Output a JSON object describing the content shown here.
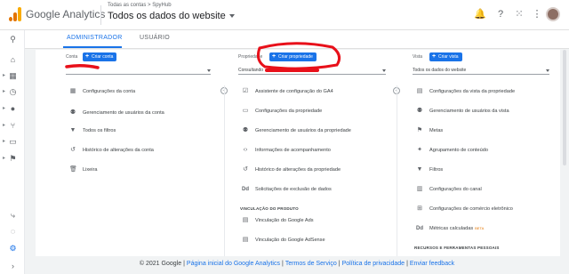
{
  "header": {
    "app_name": "Google Analytics",
    "breadcrumb": "Todas as contas > SpyHub",
    "property_title": "Todos os dados do website",
    "icons": [
      "bell-icon",
      "help-icon",
      "apps-icon",
      "more-vert-icon"
    ]
  },
  "tabs": [
    "ADMINISTRADOR",
    "USUÁRIO"
  ],
  "account": {
    "header": "Conta",
    "create_label": "Criar conta",
    "items": [
      {
        "icon": "building-icon",
        "label": "Configurações da conta"
      },
      {
        "icon": "people-icon",
        "label": "Gerenciamento de usuários da conta"
      },
      {
        "icon": "filter-icon",
        "label": "Todos os filtros"
      },
      {
        "icon": "history-icon",
        "label": "Histórico de alterações da conta"
      },
      {
        "icon": "trash-icon",
        "label": "Lixeira"
      }
    ]
  },
  "property": {
    "header": "Propriedade",
    "create_label": "Criar propriedade",
    "select_prefix": "Consultando",
    "items": [
      {
        "icon": "check-circle-icon",
        "label": "Assistente de configuração do GA4"
      },
      {
        "icon": "window-icon",
        "label": "Configurações da propriedade"
      },
      {
        "icon": "people-icon",
        "label": "Gerenciamento de usuários da propriedade"
      },
      {
        "icon": "code-icon",
        "label": "Informações de acompanhamento"
      },
      {
        "icon": "history-icon",
        "label": "Histórico de alterações da propriedade"
      },
      {
        "icon": "dd-icon",
        "label": "Solicitações de exclusão de dados"
      }
    ],
    "section_title": "VINCULAÇÃO DO PRODUTO",
    "product_links": [
      {
        "icon": "ads-icon",
        "label": "Vinculação do Google Ads"
      },
      {
        "icon": "adsense-icon",
        "label": "Vinculação do Google AdSense"
      }
    ]
  },
  "view": {
    "header": "Vista",
    "create_label": "Criar vista",
    "select_value": "Todos os dados do website",
    "items": [
      {
        "icon": "document-icon",
        "label": "Configurações da vista da propriedade"
      },
      {
        "icon": "people-icon",
        "label": "Gerenciamento de usuários da vista"
      },
      {
        "icon": "flag-icon",
        "label": "Metas"
      },
      {
        "icon": "person-walk-icon",
        "label": "Agrupamento de conteúdo"
      },
      {
        "icon": "filter-icon",
        "label": "Filtros"
      },
      {
        "icon": "channel-icon",
        "label": "Configurações do canal"
      },
      {
        "icon": "cart-icon",
        "label": "Configurações de comércio eletrônico"
      },
      {
        "icon": "dd-icon",
        "label": "Métricas calculadas",
        "badge": "BETA"
      }
    ],
    "section_title": "RECURSOS E FERRAMENTAS PESSOAIS"
  },
  "footer": {
    "copyright": "© 2021 Google",
    "links": [
      "Página inicial do Google Analytics",
      "Termos de Serviço",
      "Política de privacidade",
      "Enviar feedback"
    ]
  },
  "colors": {
    "accent": "#1a73e8",
    "annotation": "#e8101a"
  }
}
